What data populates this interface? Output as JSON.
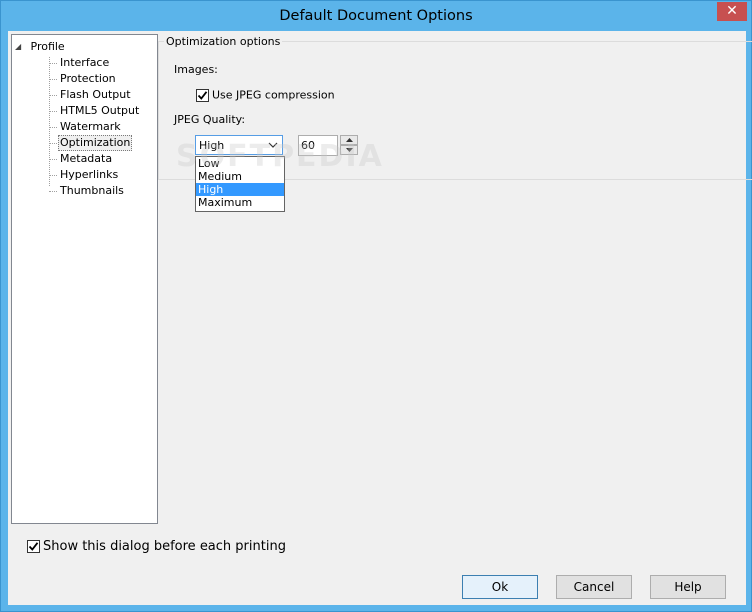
{
  "window": {
    "title": "Default Document Options",
    "close_glyph": "✕"
  },
  "tree": {
    "root": "Profile",
    "items": [
      "Interface",
      "Protection",
      "Flash Output",
      "HTML5 Output",
      "Watermark",
      "Optimization",
      "Metadata",
      "Hyperlinks",
      "Thumbnails"
    ],
    "selected": "Optimization"
  },
  "optimization": {
    "group_title": "Optimization options",
    "images_label": "Images:",
    "jpeg_compression_label": "Use JPEG compression",
    "jpeg_compression_checked": true,
    "quality_label": "JPEG Quality:",
    "quality_selected": "High",
    "quality_options": [
      "Low",
      "Medium",
      "High",
      "Maximum"
    ],
    "quality_value": "60"
  },
  "watermark_text": "SOFTPEDIA",
  "footer": {
    "show_dialog_label": "Show this dialog before each printing",
    "show_dialog_checked": true,
    "ok_label": "Ok",
    "cancel_label": "Cancel",
    "help_label": "Help"
  },
  "colors": {
    "titlebar": "#5bb4ea",
    "close": "#c75050",
    "selection": "#3399ff"
  }
}
